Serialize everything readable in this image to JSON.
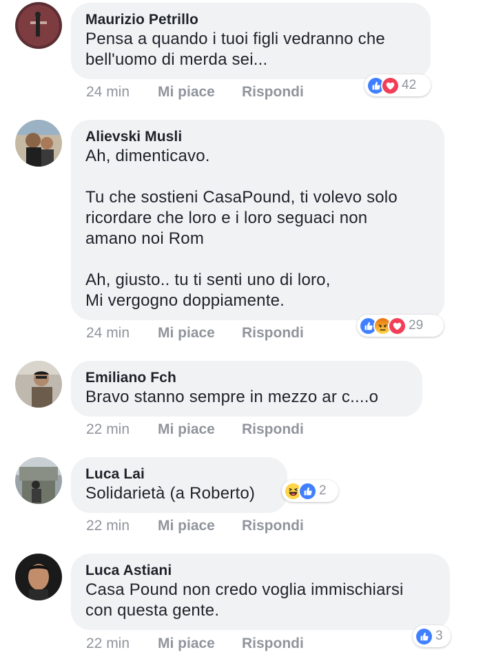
{
  "comments": [
    {
      "author": "Maurizio Petrillo",
      "text": "Pensa a quando i tuoi figli vedranno che\nbell'uomo di merda sei...",
      "time": "24 min",
      "like_label": "Mi piace",
      "reply_label": "Rispondi",
      "reactions": [
        "like",
        "love"
      ],
      "reaction_count": "42"
    },
    {
      "author": "Alievski Musli",
      "text": "Ah, dimenticavo.\n\nTu che sostieni CasaPound, ti volevo solo\nricordare che loro e i loro seguaci non\namano noi Rom\n\nAh, giusto.. tu ti senti uno di loro,\nMi vergogno doppiamente.",
      "time": "24 min",
      "like_label": "Mi piace",
      "reply_label": "Rispondi",
      "reactions": [
        "like",
        "angry",
        "love"
      ],
      "reaction_count": "29"
    },
    {
      "author": "Emiliano Fch",
      "text": "Bravo stanno sempre in mezzo ar c....o",
      "time": "22 min",
      "like_label": "Mi piace",
      "reply_label": "Rispondi"
    },
    {
      "author": "Luca Lai",
      "text": "Solidarietà (a Roberto)",
      "time": "22 min",
      "like_label": "Mi piace",
      "reply_label": "Rispondi",
      "reactions": [
        "haha",
        "like"
      ],
      "reaction_count": "2"
    },
    {
      "author": "Luca Astiani",
      "text": "Casa Pound non credo voglia immischiarsi\ncon questa gente.",
      "time": "22 min",
      "like_label": "Mi piace",
      "reply_label": "Rispondi",
      "reactions": [
        "like"
      ],
      "reaction_count": "3"
    }
  ],
  "colors": {
    "bubble": "#f1f2f4",
    "text": "#1d2129",
    "meta": "#90949c",
    "like_blue": "#4080ff",
    "love_red": "#f33e58",
    "angry_orange": "#e9710f",
    "haha_yellow": "#fcd54a"
  }
}
